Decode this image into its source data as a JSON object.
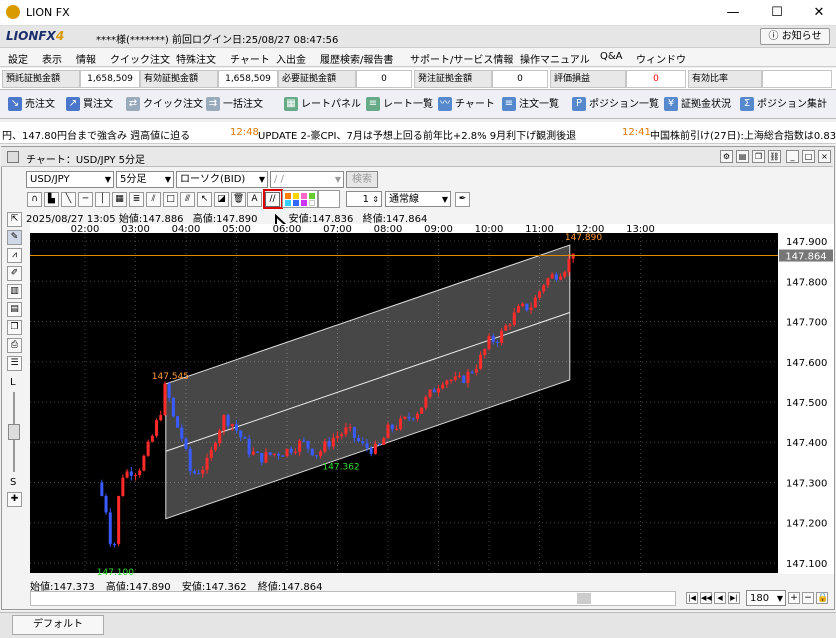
{
  "window": {
    "title": "LION FX",
    "min": "—",
    "max": "☐",
    "close": "✕"
  },
  "brand": {
    "logo": "LIONFX",
    "logo_suffix": "4",
    "user": "****様(*******)",
    "login_label": "前回ログイン日:25/08/27 08:47:56",
    "notice": "お知らせ"
  },
  "menu": [
    "設定",
    "表示",
    "情報",
    "クイック注文",
    "特殊注文",
    "チャート",
    "入出金",
    "履歴検索/報告書",
    "サポート/サービス情報",
    "操作マニュアル",
    "Q&A",
    "ウィンドウ"
  ],
  "margin": [
    {
      "label": "預託証拠金額",
      "value": "1,658,509"
    },
    {
      "label": "有効証拠金額",
      "value": "1,658,509"
    },
    {
      "label": "必要証拠金額",
      "value": "0"
    },
    {
      "label": "発注証拠金額",
      "value": "0"
    },
    {
      "label": "評価損益",
      "value": "0"
    },
    {
      "label": "有効比率",
      "value": ""
    }
  ],
  "toolbar": [
    "売注文",
    "買注文",
    "クイック注文",
    "一括注文",
    "レートパネル",
    "レート一覧",
    "チャート",
    "注文一覧",
    "ポジション一覧",
    "証拠金状況",
    "ポジション集計"
  ],
  "ticker": [
    {
      "time": "",
      "text": "円、147.80円台まで強含み 週高値に迫る"
    },
    {
      "time": "12:48",
      "text": "UPDATE 2-豪CPI、7月は予想上回る前年比+2.8% 9月利下げ観測後退"
    },
    {
      "time": "12:41",
      "text": "中国株前引け(27日):上海総合指数は0.83"
    }
  ],
  "chart": {
    "title": "チャート：USD/JPY 5分足",
    "symbol": "USD/JPY",
    "period": "5分足",
    "candle": "ローソク(BID)",
    "date_placeholder": "/ /",
    "search": "検索",
    "line_width": "1",
    "line_style": "通常線",
    "info": {
      "datetime": "2025/08/27 13:05",
      "open": "始値:147.886",
      "high": "高値:147.890",
      "low": "安値:147.836",
      "close": "終値:147.864"
    },
    "bottom_info": {
      "open": "始値:147.373",
      "high": "高値:147.890",
      "low": "安値:147.362",
      "close": "終値:147.864"
    },
    "left_labels": {
      "l": "L",
      "s": "S"
    },
    "zoom": "180",
    "tab": "デフォルト"
  },
  "colors": {
    "up": "#ff2a2a",
    "down": "#3a5bff",
    "price_line": "#e08a00",
    "highlight": "#e00000"
  },
  "chart_data": {
    "type": "candlestick",
    "x_ticks": [
      "02:00",
      "03:00",
      "04:00",
      "05:00",
      "06:00",
      "07:00",
      "08:00",
      "09:00",
      "10:00",
      "11:00",
      "12:00",
      "13:00"
    ],
    "y_ticks": [
      "147.900",
      "147.800",
      "147.700",
      "147.600",
      "147.500",
      "147.400",
      "147.300",
      "147.200",
      "147.100"
    ],
    "ylim": [
      147.075,
      147.92
    ],
    "current_price": "147.864",
    "annotations": {
      "high1": "147.545",
      "low1": "147.100",
      "low2": "147.362",
      "high2": "147.890"
    },
    "path": [
      [
        1.25,
        147.3
      ],
      [
        1.45,
        147.22
      ],
      [
        1.55,
        147.1
      ],
      [
        1.65,
        147.25
      ],
      [
        1.75,
        147.32
      ],
      [
        1.9,
        147.33
      ],
      [
        2.05,
        147.33
      ],
      [
        2.2,
        147.37
      ],
      [
        2.35,
        147.42
      ],
      [
        2.5,
        147.48
      ],
      [
        2.6,
        147.545
      ],
      [
        2.75,
        147.46
      ],
      [
        2.9,
        147.42
      ],
      [
        3.0,
        147.37
      ],
      [
        3.1,
        147.32
      ],
      [
        3.25,
        147.33
      ],
      [
        3.45,
        147.35
      ],
      [
        3.6,
        147.42
      ],
      [
        3.75,
        147.46
      ],
      [
        3.9,
        147.45
      ],
      [
        4.05,
        147.42
      ],
      [
        4.25,
        147.38
      ],
      [
        4.45,
        147.36
      ],
      [
        4.7,
        147.37
      ],
      [
        5.0,
        147.38
      ],
      [
        5.3,
        147.4
      ],
      [
        5.6,
        147.37
      ],
      [
        5.9,
        147.41
      ],
      [
        6.2,
        147.43
      ],
      [
        6.5,
        147.39
      ],
      [
        6.8,
        147.38
      ],
      [
        7.0,
        147.43
      ],
      [
        7.3,
        147.45
      ],
      [
        7.6,
        147.48
      ],
      [
        7.9,
        147.53
      ],
      [
        8.1,
        147.56
      ],
      [
        8.4,
        147.55
      ],
      [
        8.6,
        147.57
      ],
      [
        8.8,
        147.6
      ],
      [
        9.0,
        147.65
      ],
      [
        9.2,
        147.66
      ],
      [
        9.4,
        147.7
      ],
      [
        9.6,
        147.73
      ],
      [
        9.85,
        147.74
      ],
      [
        10.1,
        147.8
      ],
      [
        10.35,
        147.82
      ],
      [
        10.55,
        147.84
      ],
      [
        10.7,
        147.89
      ]
    ],
    "channel": {
      "top_start": [
        2.6,
        147.545
      ],
      "top_end": [
        10.6,
        147.89
      ],
      "bottom_start": [
        2.6,
        147.21
      ],
      "bottom_end": [
        10.6,
        147.555
      ]
    }
  }
}
